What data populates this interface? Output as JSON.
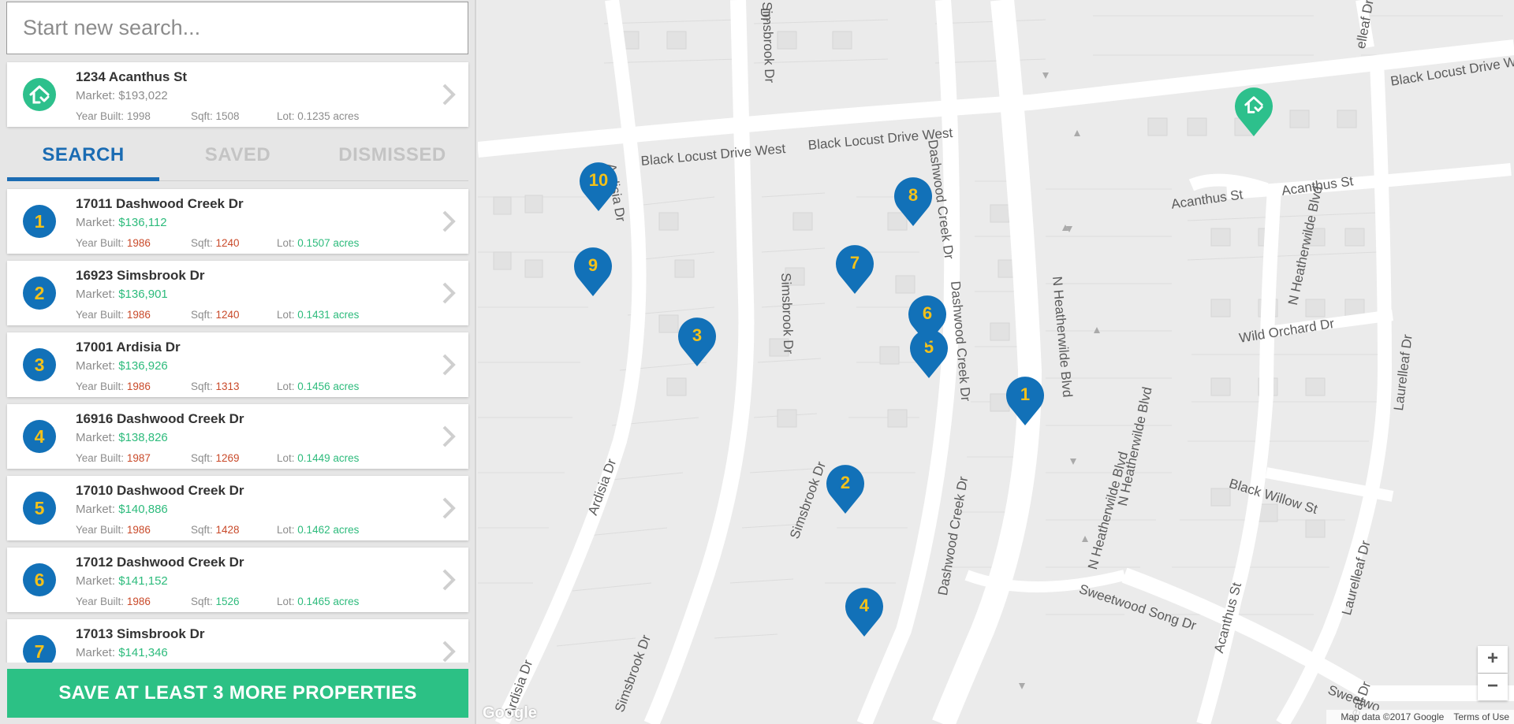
{
  "search": {
    "placeholder": "Start new search..."
  },
  "home": {
    "address": "1234 Acanthus St",
    "market_label": "Market:",
    "market": "$193,022",
    "year_label": "Year Built:",
    "year": "1998",
    "sqft_label": "Sqft:",
    "sqft": "1508",
    "lot_label": "Lot:",
    "lot": "0.1235 acres",
    "icon": "house-check-icon"
  },
  "tabs": [
    {
      "label": "SEARCH",
      "active": true
    },
    {
      "label": "SAVED",
      "active": false
    },
    {
      "label": "DISMISSED",
      "active": false
    }
  ],
  "labels": {
    "market": "Market:",
    "year": "Year Built:",
    "sqft": "Sqft:",
    "lot": "Lot:"
  },
  "properties": [
    {
      "num": "1",
      "address": "17011 Dashwood Creek Dr",
      "market": "$136,112",
      "year": "1986",
      "sqft": "1240",
      "lot": "0.1507 acres",
      "sqft_color": "red"
    },
    {
      "num": "2",
      "address": "16923 Simsbrook Dr",
      "market": "$136,901",
      "year": "1986",
      "sqft": "1240",
      "lot": "0.1431 acres",
      "sqft_color": "red"
    },
    {
      "num": "3",
      "address": "17001 Ardisia Dr",
      "market": "$136,926",
      "year": "1986",
      "sqft": "1313",
      "lot": "0.1456 acres",
      "sqft_color": "red"
    },
    {
      "num": "4",
      "address": "16916 Dashwood Creek Dr",
      "market": "$138,826",
      "year": "1987",
      "sqft": "1269",
      "lot": "0.1449 acres",
      "sqft_color": "red"
    },
    {
      "num": "5",
      "address": "17010 Dashwood Creek Dr",
      "market": "$140,886",
      "year": "1986",
      "sqft": "1428",
      "lot": "0.1462 acres",
      "sqft_color": "red"
    },
    {
      "num": "6",
      "address": "17012 Dashwood Creek Dr",
      "market": "$141,152",
      "year": "1986",
      "sqft": "1526",
      "lot": "0.1465 acres",
      "sqft_color": "green"
    },
    {
      "num": "7",
      "address": "17013 Simsbrook Dr",
      "market": "$141,346",
      "year": "",
      "sqft": "",
      "lot": "",
      "sqft_color": "red"
    }
  ],
  "cta": {
    "label": "SAVE AT LEAST 3 MORE PROPERTIES"
  },
  "map": {
    "streets": [
      "Black Locust Drive West",
      "Black Locust Drive West",
      "Black Locust Drive W",
      "Acanthus St",
      "Acanthus St",
      "Wild Orchard Dr",
      "Black Willow St",
      "Sweetwood Song Dr",
      "Sweetwo",
      "Simsbrook Dr",
      "Simsbrook Dr",
      "Simsbrook Dr",
      "Simsbrook Dr",
      "Ardisia Dr",
      "Ardisia Dr",
      "Ardisia Dr",
      "Dashwood Creek Dr",
      "Dashwood Creek Dr",
      "Dashwood Creek Dr",
      "N Heatherwilde Blvd",
      "N Heatherwilde Blvd",
      "N Heatherwilde Blvd",
      "N Heatherwilde Blvd",
      "Laurelleaf Dr",
      "Laurelleaf Dr",
      "elleaf Dr",
      "Acanthus St",
      "lleaf Dr",
      "Dr"
    ],
    "pins": [
      "1",
      "2",
      "3",
      "4",
      "5",
      "6",
      "7",
      "8",
      "9",
      "10"
    ],
    "zoom_in": "+",
    "zoom_out": "−",
    "attribution": "Map data ©2017 Google",
    "terms": "Terms of Use",
    "google": "Google",
    "pin_color": "#1271b8",
    "home_pin_color": "#2dc08c"
  }
}
